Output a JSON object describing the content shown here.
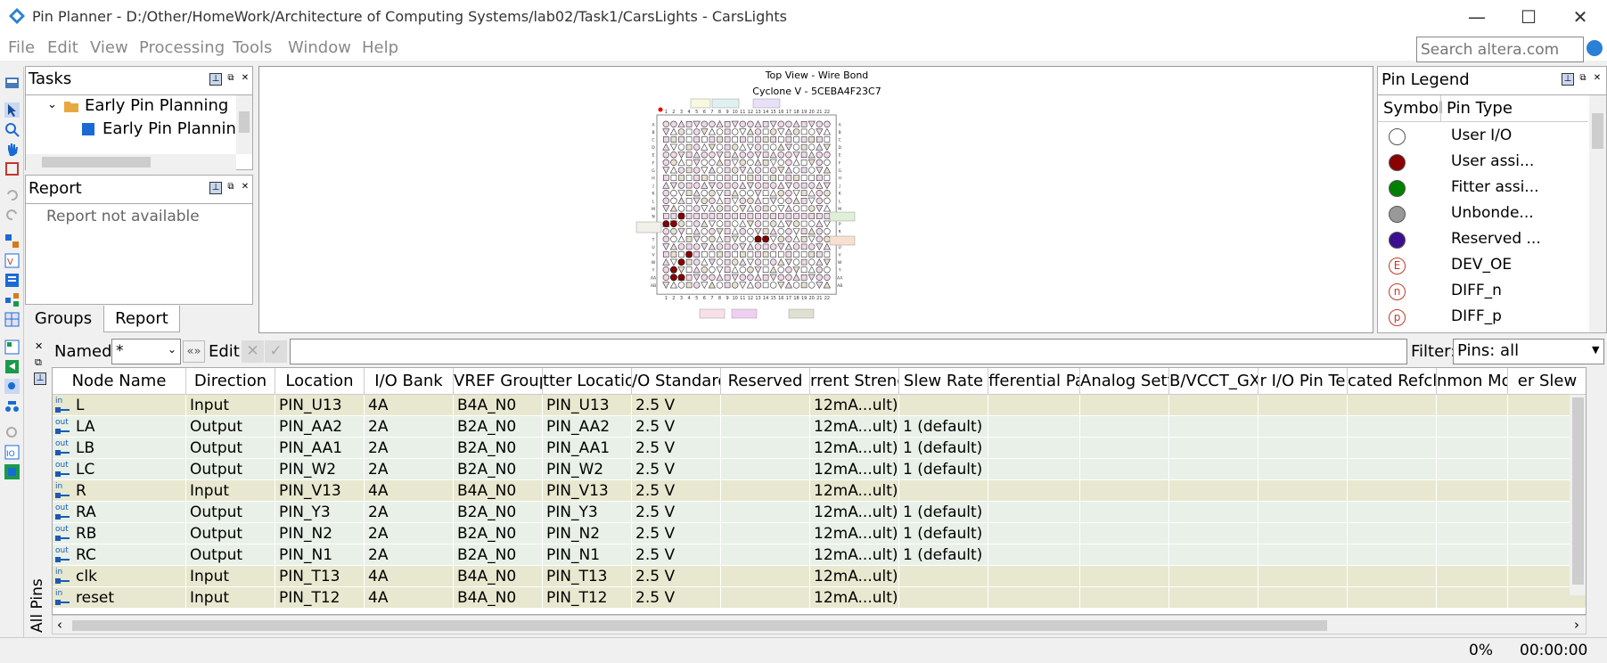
{
  "window": {
    "title": "Pin Planner - D:/Other/HomeWork/Architecture of Computing Systems/lab02/Task1/CarsLights - CarsLights",
    "minimize": "—",
    "maximize": "☐",
    "close": "✕"
  },
  "menu": [
    "File",
    "Edit",
    "View",
    "Processing",
    "Tools",
    "Window",
    "Help"
  ],
  "search": {
    "placeholder": "Search altera.com"
  },
  "tasks": {
    "title": "Tasks",
    "items": [
      "Early Pin Planning",
      "Early Pin Planning"
    ]
  },
  "report": {
    "title": "Report",
    "message": "Report not available"
  },
  "bottom_tabs": [
    "Groups",
    "Report"
  ],
  "chip_view": {
    "title": "Top View - Wire Bond",
    "subtitle": "Cyclone V - 5CEBA4F23C7",
    "col_labels": [
      "1",
      "2",
      "3",
      "4",
      "5",
      "6",
      "7",
      "8",
      "9",
      "10",
      "11",
      "12",
      "13",
      "14",
      "15",
      "16",
      "17",
      "18",
      "19",
      "20",
      "21",
      "22"
    ],
    "row_labels": [
      "A",
      "B",
      "C",
      "D",
      "E",
      "F",
      "G",
      "H",
      "J",
      "K",
      "L",
      "M",
      "N",
      "P",
      "R",
      "T",
      "U",
      "V",
      "W",
      "Y",
      "AA",
      "AB"
    ]
  },
  "legend": {
    "title": "Pin Legend",
    "col_symbol": "Symbol",
    "col_type": "Pin Type",
    "items": [
      {
        "label": "User I/O",
        "color": "#ffffff",
        "glyph": ""
      },
      {
        "label": "User assi...",
        "color": "#8b0000",
        "glyph": ""
      },
      {
        "label": "Fitter assi...",
        "color": "#008000",
        "glyph": ""
      },
      {
        "label": "Unbonde...",
        "color": "#999999",
        "glyph": ""
      },
      {
        "label": "Reserved ...",
        "color": "#3b0f8f",
        "glyph": ""
      },
      {
        "label": "DEV_OE",
        "color": "#ffffff",
        "glyph": "E"
      },
      {
        "label": "DIFF_n",
        "color": "#ffffff",
        "glyph": "n"
      },
      {
        "label": "DIFF_p",
        "color": "#ffffff",
        "glyph": "p"
      }
    ]
  },
  "filterbar": {
    "named_label": "Named:",
    "named_value": "*",
    "edit_label": "Edit:",
    "filter_label": "Filter:",
    "filter_value": "Pins: all"
  },
  "side_tab": "All Pins",
  "table": {
    "columns": [
      "Node Name",
      "Direction",
      "Location",
      "I/O Bank",
      "VREF Group",
      "Fitter Location",
      "I/O Standard",
      "Reserved",
      "Current Strength",
      "Slew Rate",
      "Differential Pair",
      "Analog Settings",
      "VCCR/VCCT_GXB",
      "Strict I/O Pin Termination",
      "Dedicated Refclk",
      "Common Mode",
      "Slew Rate"
    ],
    "column_display": [
      "Node Name",
      "Direction",
      "Location",
      "I/O Bank",
      "VREF Group",
      "tter Location",
      "/O Standard",
      "Reserved",
      "rrent Streng",
      "Slew Rate",
      "fferential Pa",
      "Analog Setti",
      "B/VCCT_GX",
      "r I/O Pin Te",
      "cated Refcll",
      "nmon Mode",
      "er Slew"
    ],
    "rows": [
      {
        "dir_icon": "in",
        "name": "L",
        "direction": "Input",
        "location": "PIN_U13",
        "bank": "4A",
        "vref": "B4A_N0",
        "fitter": "PIN_U13",
        "std": "2.5 V",
        "reserved": "",
        "current": "12mA...ult)",
        "slew": ""
      },
      {
        "dir_icon": "out",
        "name": "LA",
        "direction": "Output",
        "location": "PIN_AA2",
        "bank": "2A",
        "vref": "B2A_N0",
        "fitter": "PIN_AA2",
        "std": "2.5 V",
        "reserved": "",
        "current": "12mA...ult)",
        "slew": "1 (default)"
      },
      {
        "dir_icon": "out",
        "name": "LB",
        "direction": "Output",
        "location": "PIN_AA1",
        "bank": "2A",
        "vref": "B2A_N0",
        "fitter": "PIN_AA1",
        "std": "2.5 V",
        "reserved": "",
        "current": "12mA...ult)",
        "slew": "1 (default)"
      },
      {
        "dir_icon": "out",
        "name": "LC",
        "direction": "Output",
        "location": "PIN_W2",
        "bank": "2A",
        "vref": "B2A_N0",
        "fitter": "PIN_W2",
        "std": "2.5 V",
        "reserved": "",
        "current": "12mA...ult)",
        "slew": "1 (default)"
      },
      {
        "dir_icon": "in",
        "name": "R",
        "direction": "Input",
        "location": "PIN_V13",
        "bank": "4A",
        "vref": "B4A_N0",
        "fitter": "PIN_V13",
        "std": "2.5 V",
        "reserved": "",
        "current": "12mA...ult)",
        "slew": ""
      },
      {
        "dir_icon": "out",
        "name": "RA",
        "direction": "Output",
        "location": "PIN_Y3",
        "bank": "2A",
        "vref": "B2A_N0",
        "fitter": "PIN_Y3",
        "std": "2.5 V",
        "reserved": "",
        "current": "12mA...ult)",
        "slew": "1 (default)"
      },
      {
        "dir_icon": "out",
        "name": "RB",
        "direction": "Output",
        "location": "PIN_N2",
        "bank": "2A",
        "vref": "B2A_N0",
        "fitter": "PIN_N2",
        "std": "2.5 V",
        "reserved": "",
        "current": "12mA...ult)",
        "slew": "1 (default)"
      },
      {
        "dir_icon": "out",
        "name": "RC",
        "direction": "Output",
        "location": "PIN_N1",
        "bank": "2A",
        "vref": "B2A_N0",
        "fitter": "PIN_N1",
        "std": "2.5 V",
        "reserved": "",
        "current": "12mA...ult)",
        "slew": "1 (default)"
      },
      {
        "dir_icon": "in",
        "name": "clk",
        "direction": "Input",
        "location": "PIN_T13",
        "bank": "4A",
        "vref": "B4A_N0",
        "fitter": "PIN_T13",
        "std": "2.5 V",
        "reserved": "",
        "current": "12mA...ult)",
        "slew": ""
      },
      {
        "dir_icon": "in",
        "name": "reset",
        "direction": "Input",
        "location": "PIN_T12",
        "bank": "4A",
        "vref": "B4A_N0",
        "fitter": "PIN_T12",
        "std": "2.5 V",
        "reserved": "",
        "current": "12mA...ult)",
        "slew": ""
      }
    ]
  },
  "status": {
    "progress": "0%",
    "time": "00:00:00"
  },
  "colors": {
    "input_row": "#e8e8d0",
    "output_row": "#e8f0e8",
    "accent": "#2a7fd6"
  }
}
